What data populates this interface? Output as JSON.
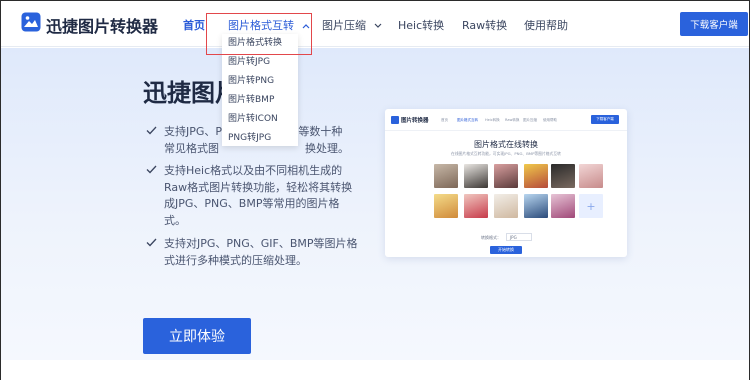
{
  "header": {
    "brand": "迅捷图片转换器",
    "nav": [
      {
        "label": "首页"
      },
      {
        "label": "图片格式互转"
      },
      {
        "label": "图片压缩"
      },
      {
        "label": "Heic转换"
      },
      {
        "label": "Raw转换"
      },
      {
        "label": "使用帮助"
      }
    ],
    "download_label": "下载客户端"
  },
  "dropdown": {
    "items": [
      "图片格式转换",
      "图片转JPG",
      "图片转PNG",
      "图片转BMP",
      "图片转ICON",
      "PNG转JPG"
    ]
  },
  "hero": {
    "title": "迅捷图片",
    "bullets": [
      "支持JPG、P",
      "F等数十种",
      "常见格式图",
      "换处理。",
      "支持Heic格式以及由不同相机生成的Raw格式图片转换功能，轻松将其转换成JPG、PNG、BMP等常用的图片格式。",
      "支持对JPG、PNG、GIF、BMP等图片格式进行多种模式的压缩处理。"
    ],
    "cta_label": "立即体验"
  },
  "mockup": {
    "brand": "图片转换器",
    "nav": [
      "首页",
      "图片格式互转",
      "Heic转换",
      "Raw转换",
      "图片压缩",
      "使用帮助"
    ],
    "download_label": "下载客户端",
    "title": "图片格式在线转换",
    "subtitle": "在线图片格式互转功能，可实现JPG、PNG、BMP等图片格式互转",
    "format_label": "转换格式：",
    "format_value": "JPG",
    "convert_label": "开始转换",
    "add_icon": "+"
  },
  "colors": {
    "accent": "#2a62dc",
    "highlight": "#e2474b",
    "text": "#1f2a44"
  }
}
